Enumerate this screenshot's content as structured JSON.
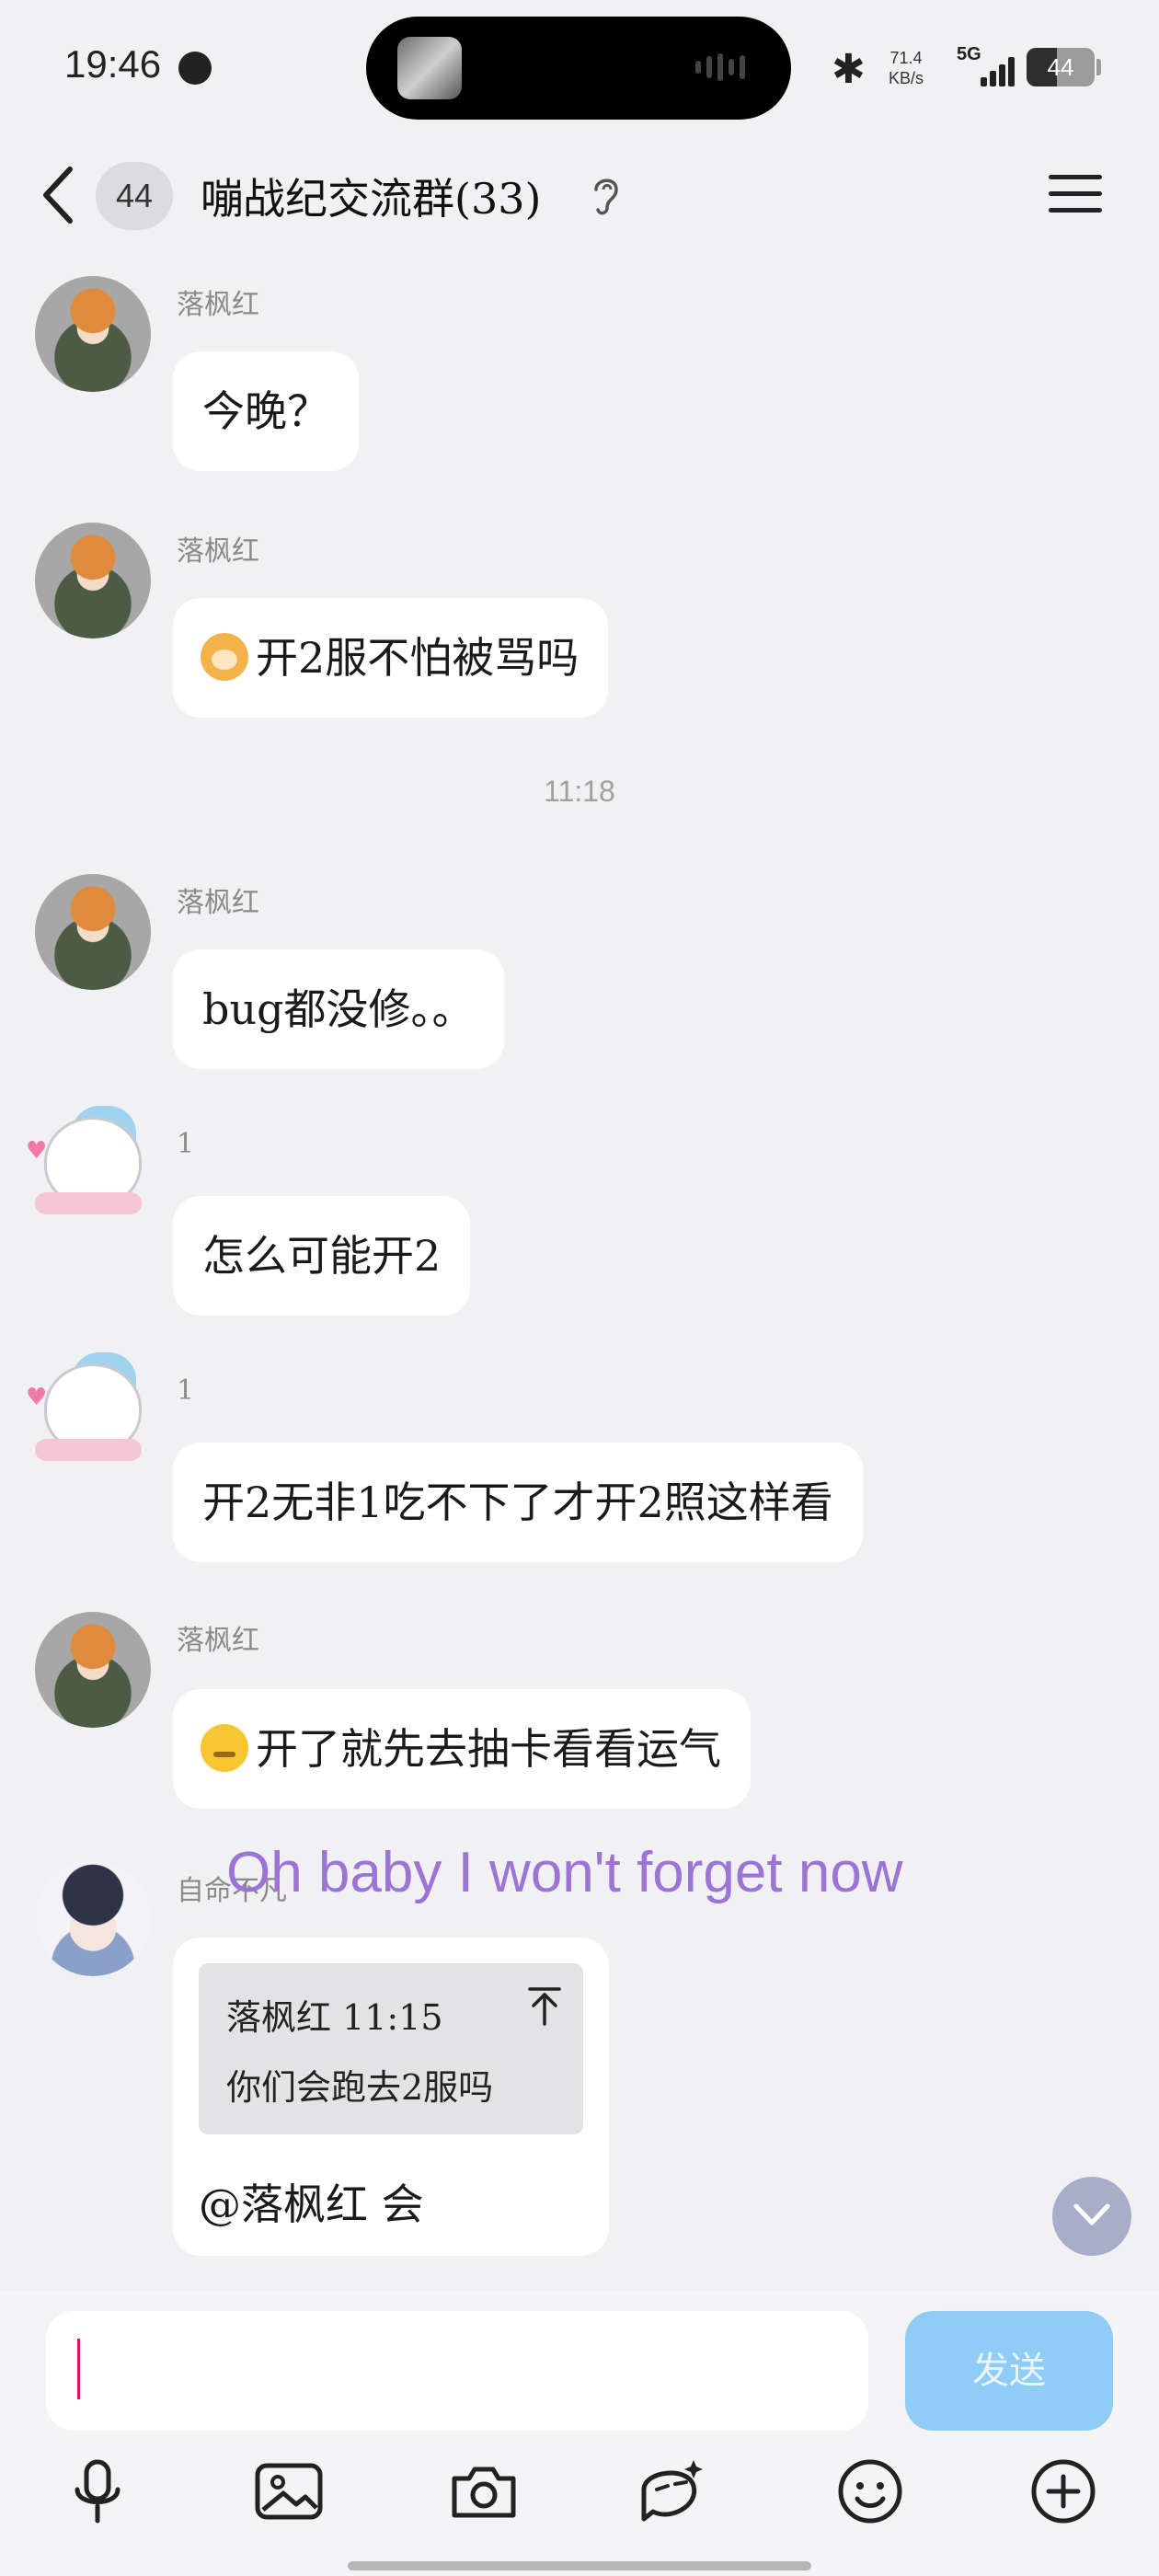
{
  "status_bar": {
    "time": "19:46",
    "net_speed_value": "71.4",
    "net_speed_unit": "KB/s",
    "network": "5G",
    "battery": "44",
    "battery_level_percent": 44
  },
  "header": {
    "unread_count": "44",
    "title": "嘣战纪交流群(33)"
  },
  "messages": [
    {
      "sender": "落枫红",
      "text": "今晚？"
    },
    {
      "sender": "落枫红",
      "text": "开2服不怕被骂吗"
    },
    {
      "time_divider": "11:18"
    },
    {
      "sender": "落枫红",
      "text": "bug都没修。。"
    },
    {
      "sender": "1",
      "text": "怎么可能开2"
    },
    {
      "sender": "1",
      "text": "开2无非1吃不下了才开2照这样看"
    },
    {
      "sender": "落枫红",
      "text": "开了就先去抽卡看看运气"
    },
    {
      "sender": "自命不凡",
      "quote_header": "落枫红 11:15",
      "quote_text": "你们会跑去2服吗",
      "text": "@落枫红 会"
    }
  ],
  "lyric_overlay": "Oh baby I won't forget now",
  "composer": {
    "send_label": "发送",
    "placeholder": ""
  },
  "colors": {
    "send_button": "#8fcdf6",
    "lyric": "#9b74d6",
    "caret": "#e0115f"
  },
  "toolbar_icons": [
    "microphone-icon",
    "image-icon",
    "camera-icon",
    "sticker-icon",
    "emoji-icon",
    "plus-icon"
  ]
}
